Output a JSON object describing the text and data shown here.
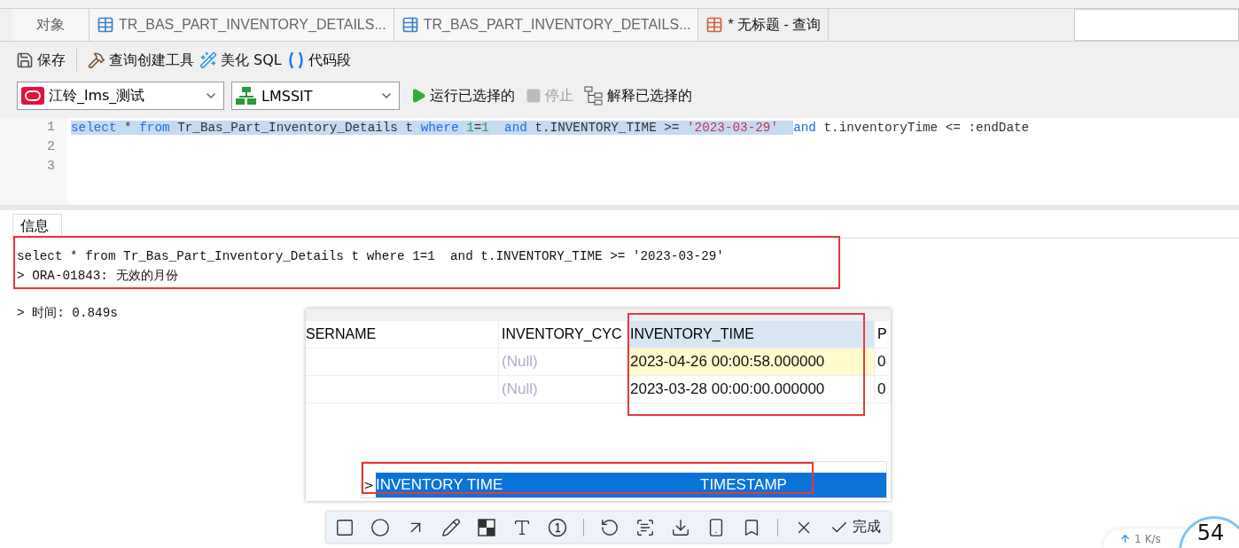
{
  "tabs": [
    {
      "label": "对象",
      "kind": "plain",
      "selected": false
    },
    {
      "label": "TR_BAS_PART_INVENTORY_DETAILS...",
      "kind": "table",
      "selected": false
    },
    {
      "label": "TR_BAS_PART_INVENTORY_DETAILS...",
      "kind": "design",
      "selected": false
    },
    {
      "label": "* 无标题 - 查询",
      "kind": "query",
      "selected": true
    }
  ],
  "toolbar": [
    {
      "label": "保存",
      "kind": "save"
    },
    {
      "label": "查询创建工具",
      "kind": "builder"
    },
    {
      "label": "美化 SQL",
      "kind": "beautify"
    },
    {
      "label": "代码段",
      "kind": "snippet"
    }
  ],
  "connection": {
    "value": "江铃_lms_测试"
  },
  "database": {
    "value": "LMSSIT"
  },
  "actions": [
    {
      "label": "运行已选择的",
      "kind": "run",
      "disabled": false
    },
    {
      "label": "停止",
      "kind": "stop",
      "disabled": true
    },
    {
      "label": "解释已选择的",
      "kind": "explain",
      "disabled": false
    }
  ],
  "editor": {
    "lines": [
      {
        "number": "1",
        "tokens": [
          {
            "text": "select",
            "kind": "keyword",
            "selected": true
          },
          {
            "text": " * ",
            "kind": "plain",
            "selected": true
          },
          {
            "text": "from",
            "kind": "keyword",
            "selected": true
          },
          {
            "text": " Tr_Bas_Part_Inventory_Details t ",
            "kind": "plain",
            "selected": true
          },
          {
            "text": "where",
            "kind": "keyword",
            "selected": true
          },
          {
            "text": " 1",
            "kind": "number",
            "selected": true
          },
          {
            "text": "=",
            "kind": "plain",
            "selected": true
          },
          {
            "text": "1",
            "kind": "number",
            "selected": true
          },
          {
            "text": "  and",
            "kind": "keyword",
            "selected": true
          },
          {
            "text": " t.INVENTORY_TIME >= ",
            "kind": "plain",
            "selected": true
          },
          {
            "text": "'2023-03-29'  ",
            "kind": "string",
            "selected": true
          },
          {
            "text": "and",
            "kind": "keyword",
            "selected": false
          },
          {
            "text": " t.inventoryTime <= :endDate",
            "kind": "plain",
            "selected": false
          }
        ]
      },
      {
        "number": "2"
      },
      {
        "number": "3"
      }
    ]
  },
  "info": {
    "tab": {
      "label": "信息",
      "selected": true
    },
    "lines": [
      {
        "kind": "query",
        "text": "select * from Tr_Bas_Part_Inventory_Details t where 1=1  and t.INVENTORY_TIME >= '2023-03-29'"
      },
      {
        "kind": "error",
        "text": "> ORA-01843: 无效的月份"
      },
      {
        "kind": "timing",
        "text": "> 时间: 0.849s"
      }
    ]
  },
  "grid": {
    "columns": [
      {
        "label": "SERNAME",
        "selected": false
      },
      {
        "label": "INVENTORY_CYC",
        "selected": false
      },
      {
        "label": "INVENTORY_TIME",
        "selected": true
      },
      {
        "label": "P",
        "selected": false
      }
    ],
    "rows": [
      {
        "selected": true,
        "cells": [
          {},
          {
            "text": "(Null)",
            "null": true
          },
          {
            "text": "2023-04-26 00:00:58.000000",
            "null": false
          },
          {
            "text": "0",
            "null": false
          }
        ]
      },
      {
        "selected": false,
        "cells": [
          {},
          {
            "text": "(Null)",
            "null": true
          },
          {
            "text": "2023-03-28 00:00:00.000000",
            "null": false
          },
          {
            "text": "0",
            "null": false
          }
        ]
      }
    ]
  },
  "fields_list": {
    "rows": [
      {
        "marker": ">",
        "name": "INVENTORY TIME",
        "type": "TIMESTAMP",
        "selected": true
      }
    ]
  },
  "capture_toolbar": {
    "tools": [
      {
        "kind": "rectangle"
      },
      {
        "kind": "circle"
      },
      {
        "kind": "arrow"
      },
      {
        "kind": "pencil"
      },
      {
        "kind": "mosaic"
      },
      {
        "kind": "text"
      },
      {
        "kind": "number"
      },
      {
        "kind": "separator"
      },
      {
        "kind": "undo"
      },
      {
        "kind": "scan"
      },
      {
        "kind": "download"
      },
      {
        "kind": "phone"
      },
      {
        "kind": "bookmark"
      },
      {
        "kind": "separator"
      },
      {
        "kind": "close"
      }
    ],
    "done": "完成"
  },
  "net_widget": {
    "upload": "1",
    "unit": "K/s",
    "value": "54"
  }
}
